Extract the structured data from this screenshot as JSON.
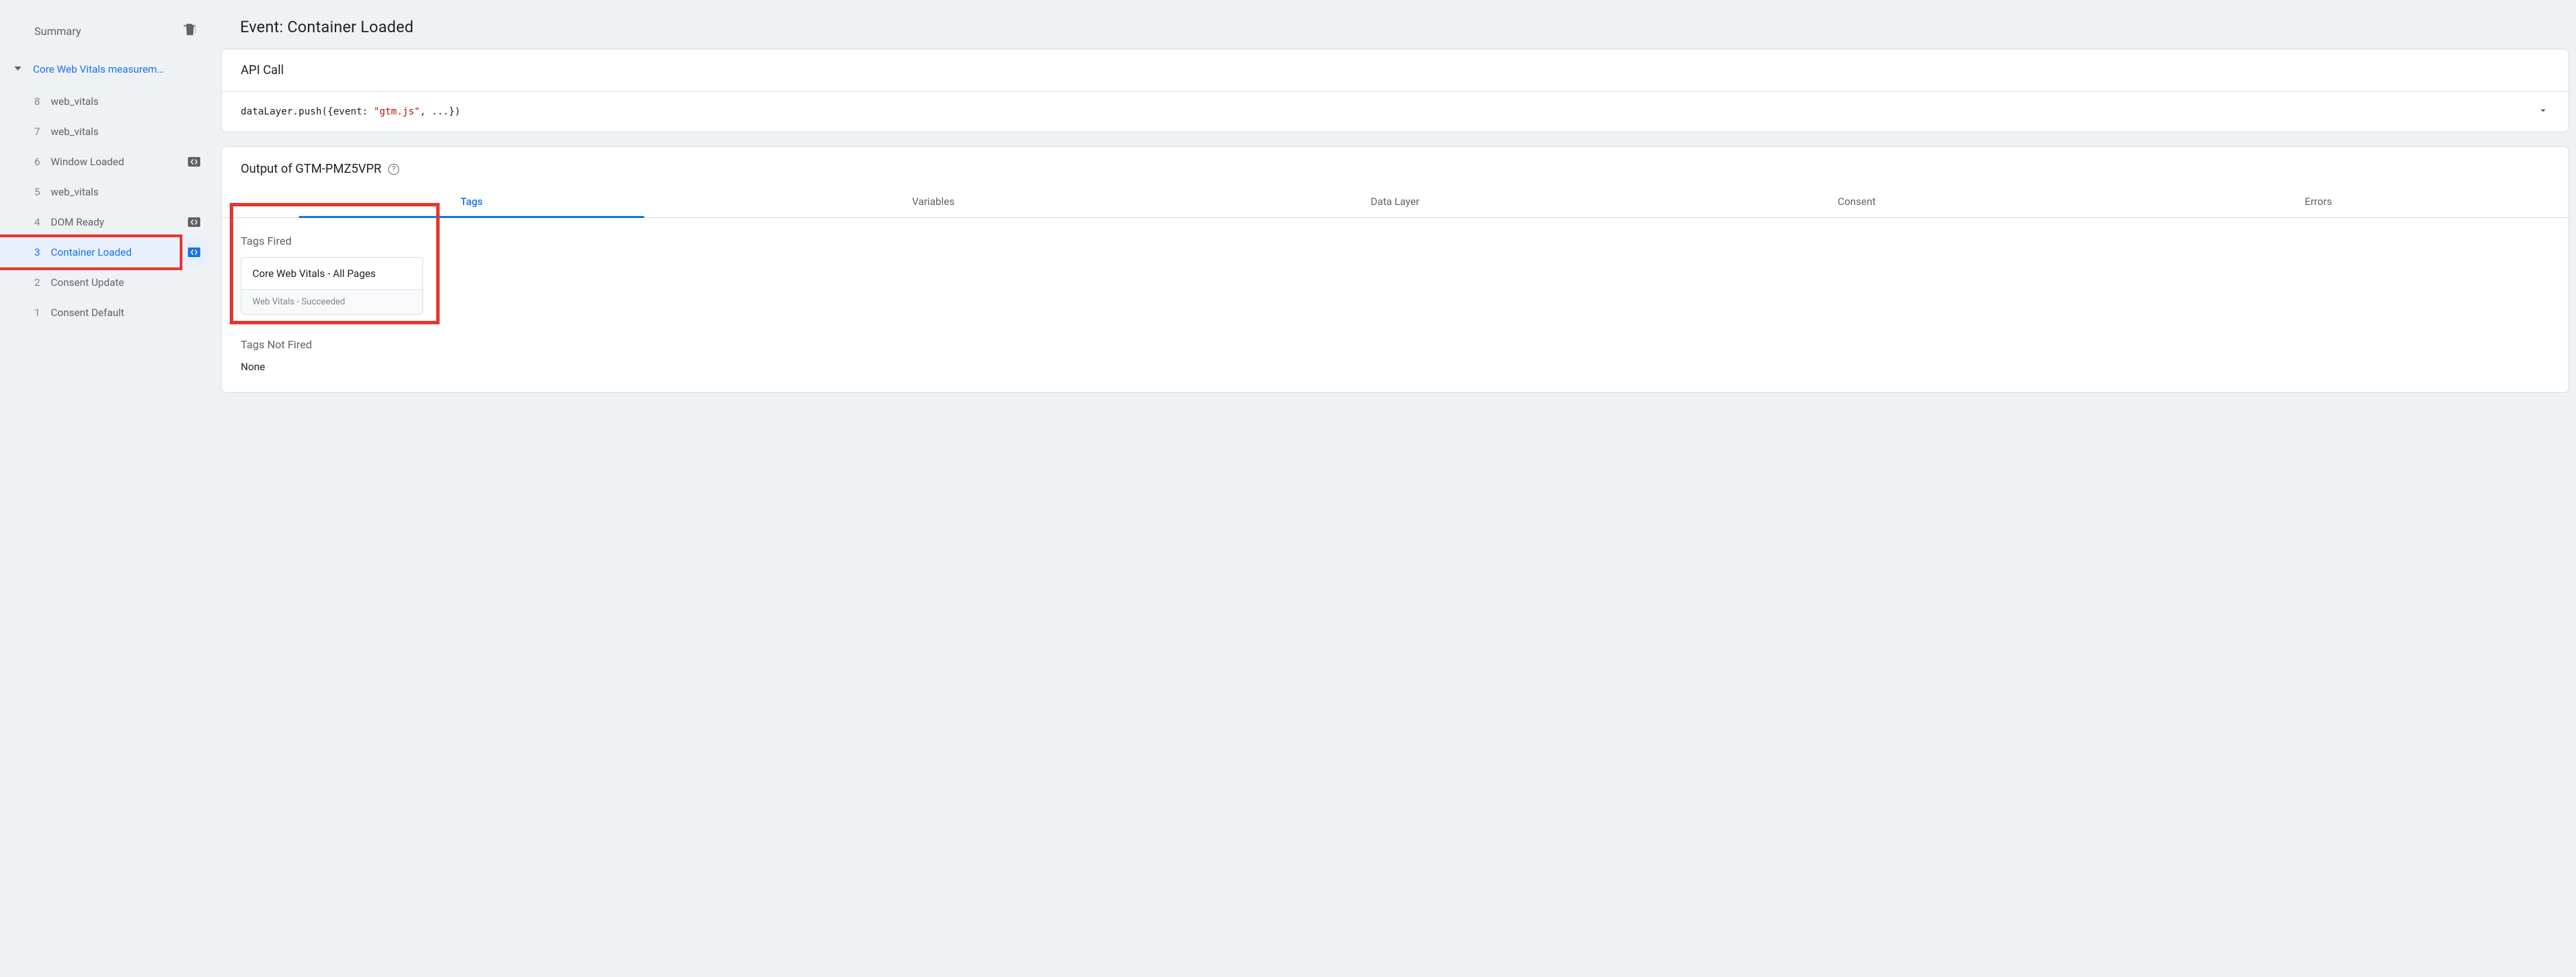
{
  "sidebar": {
    "title": "Summary",
    "root_label": "Core Web Vitals measurem…",
    "events": [
      {
        "num": "8",
        "label": "web_vitals",
        "icon": null
      },
      {
        "num": "7",
        "label": "web_vitals",
        "icon": null
      },
      {
        "num": "6",
        "label": "Window Loaded",
        "icon": "dark"
      },
      {
        "num": "5",
        "label": "web_vitals",
        "icon": null
      },
      {
        "num": "4",
        "label": "DOM Ready",
        "icon": "dark"
      },
      {
        "num": "3",
        "label": "Container Loaded",
        "icon": "blue",
        "selected": true,
        "highlighted": true
      },
      {
        "num": "2",
        "label": "Consent Update",
        "icon": null
      },
      {
        "num": "1",
        "label": "Consent Default",
        "icon": null
      }
    ]
  },
  "main": {
    "title": "Event: Container Loaded",
    "api_call": {
      "heading": "API Call",
      "code_prefix": "dataLayer.push({event: ",
      "code_string": "\"gtm.js\"",
      "code_suffix": ", ...})"
    },
    "output": {
      "heading": "Output of GTM-PMZ5VPR",
      "tabs": [
        "Tags",
        "Variables",
        "Data Layer",
        "Consent",
        "Errors"
      ],
      "active_tab_index": 0,
      "tags_fired_label": "Tags Fired",
      "fired_tags": [
        {
          "title": "Core Web Vitals - All Pages",
          "status": "Web Vitals - Succeeded"
        }
      ],
      "tags_not_fired_label": "Tags Not Fired",
      "tags_not_fired_value": "None"
    }
  }
}
